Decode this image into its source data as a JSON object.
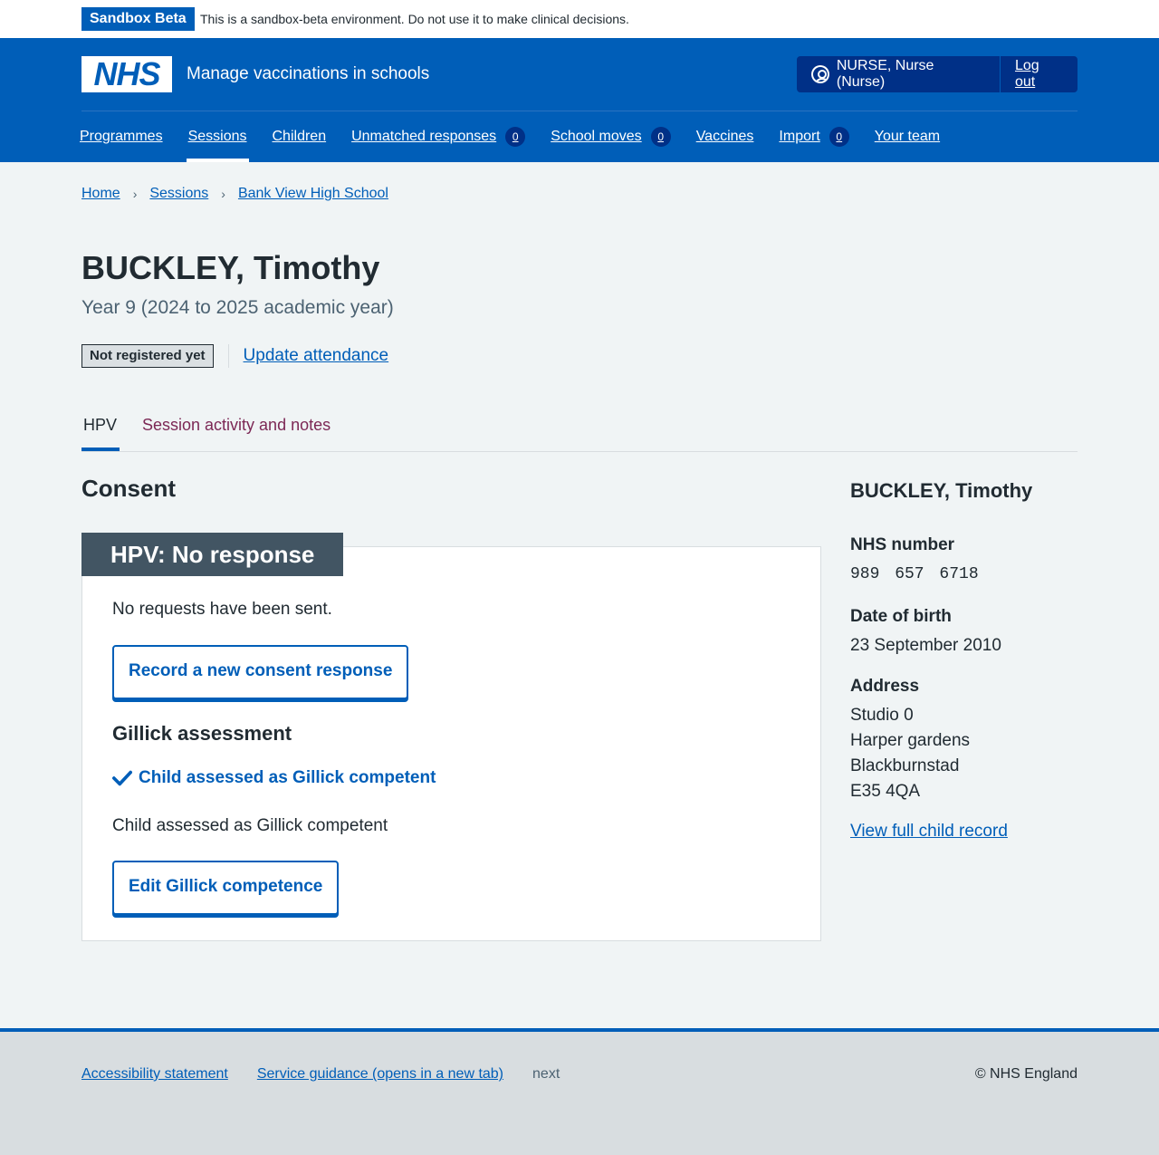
{
  "phase": {
    "tag": "Sandbox Beta",
    "text": "This is a sandbox-beta environment. Do not use it to make clinical decisions."
  },
  "header": {
    "logo_text": "NHS",
    "service_name": "Manage vaccinations in schools",
    "user": "NURSE, Nurse (Nurse)",
    "logout": "Log out",
    "user_icon": "user-icon"
  },
  "nav": {
    "items": [
      {
        "label": "Programmes"
      },
      {
        "label": "Sessions",
        "active": true
      },
      {
        "label": "Children"
      },
      {
        "label": "Unmatched responses",
        "badge": "0"
      },
      {
        "label": "School moves",
        "badge": "0"
      },
      {
        "label": "Vaccines"
      },
      {
        "label": "Import",
        "badge": "0"
      },
      {
        "label": "Your team"
      }
    ]
  },
  "breadcrumb": [
    "Home",
    "Sessions",
    "Bank View High School"
  ],
  "page": {
    "title": "BUCKLEY, Timothy",
    "subtitle": "Year 9 (2024 to 2025 academic year)",
    "status_tag": "Not registered yet",
    "update_link": "Update attendance"
  },
  "tabs": [
    "HPV",
    "Session activity and notes"
  ],
  "consent": {
    "section_title": "Consent",
    "card_heading": "HPV: No response",
    "no_requests": "No requests have been sent.",
    "record_button": "Record a new consent response",
    "gillick_heading": "Gillick assessment",
    "gillick_status": "Child assessed as Gillick competent",
    "gillick_text": "Child assessed as Gillick competent",
    "edit_button": "Edit Gillick competence"
  },
  "sidebar": {
    "name": "BUCKLEY, Timothy",
    "nhs_label": "NHS number",
    "nhs_value": "989 657 6718",
    "dob_label": "Date of birth",
    "dob_value": "23 September 2010",
    "address_label": "Address",
    "address_lines": [
      "Studio 0",
      "Harper gardens",
      "Blackburnstad",
      "E35 4QA"
    ],
    "view_link": "View full child record"
  },
  "footer": {
    "links": [
      "Accessibility statement",
      "Service guidance (opens in a new tab)"
    ],
    "next": "next",
    "copyright": "© NHS England"
  },
  "colors": {
    "nhs_blue": "#005eb8",
    "dark_blue": "#003087",
    "card_heading_bg": "#425563",
    "page_bg": "#f0f4f5"
  }
}
